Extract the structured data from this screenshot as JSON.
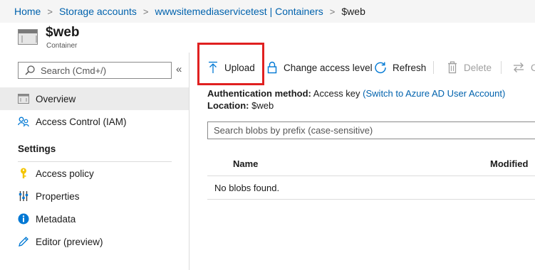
{
  "breadcrumb": {
    "items": [
      "Home",
      "Storage accounts",
      "wwwsitemediaservicetest | Containers"
    ],
    "current": "$web",
    "separator": ">"
  },
  "header": {
    "title": "$web",
    "subtitle": "Container"
  },
  "sidebar": {
    "search_placeholder": "Search (Cmd+/)",
    "collapse_glyph": "«",
    "items": [
      {
        "label": "Overview",
        "icon": "container-icon",
        "active": true
      },
      {
        "label": "Access Control (IAM)",
        "icon": "people-icon",
        "active": false
      }
    ],
    "section_title": "Settings",
    "settings_items": [
      {
        "label": "Access policy",
        "icon": "key-icon"
      },
      {
        "label": "Properties",
        "icon": "properties-icon"
      },
      {
        "label": "Metadata",
        "icon": "info-icon"
      },
      {
        "label": "Editor (preview)",
        "icon": "pencil-icon"
      }
    ]
  },
  "toolbar": {
    "upload": "Upload",
    "change_access": "Change access level",
    "refresh": "Refresh",
    "delete": "Delete",
    "change_tier": "C"
  },
  "info": {
    "auth_label": "Authentication method:",
    "auth_value": "Access key",
    "auth_link": "(Switch to Azure AD User Account)",
    "location_label": "Location:",
    "location_value": "$web"
  },
  "blobs": {
    "search_placeholder": "Search blobs by prefix (case-sensitive)",
    "columns": [
      "Name",
      "Modified"
    ],
    "empty_message": "No blobs found."
  },
  "colors": {
    "link": "#0062ad",
    "highlight": "#e02020",
    "accent": "#0078d4"
  }
}
